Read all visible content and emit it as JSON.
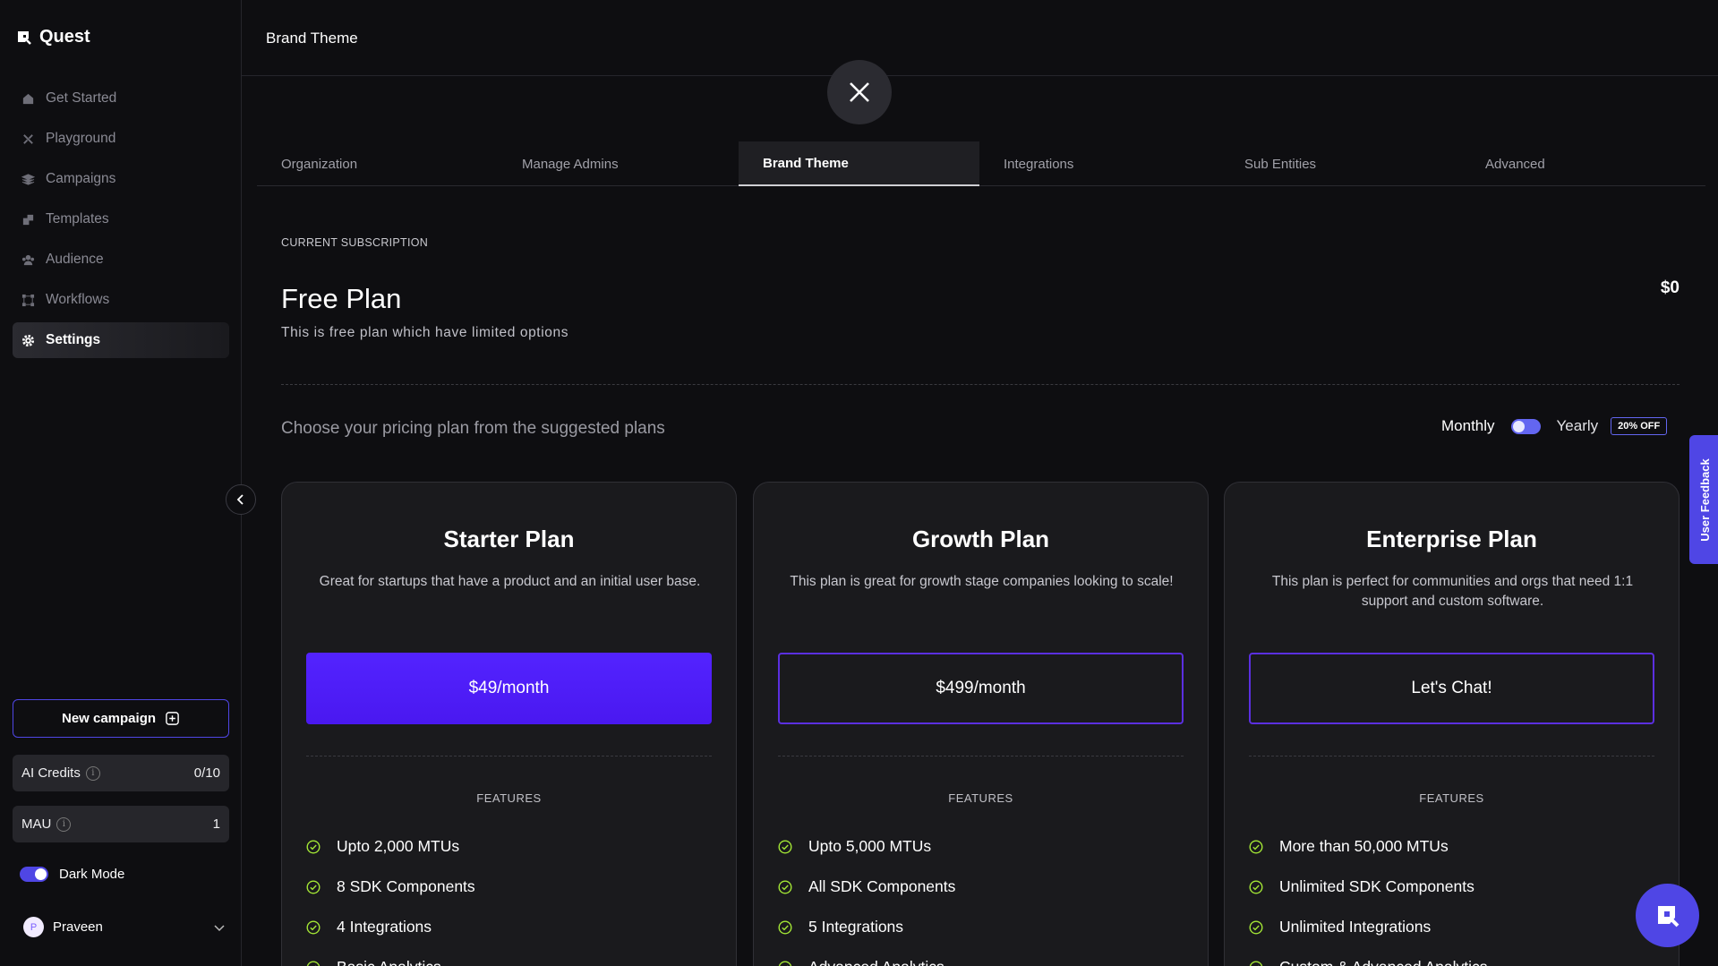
{
  "app": {
    "name": "Quest"
  },
  "sidebar": {
    "items": [
      {
        "label": "Get Started",
        "icon": "home-icon"
      },
      {
        "label": "Playground",
        "icon": "playground-icon"
      },
      {
        "label": "Campaigns",
        "icon": "campaigns-icon"
      },
      {
        "label": "Templates",
        "icon": "templates-icon"
      },
      {
        "label": "Audience",
        "icon": "audience-icon"
      },
      {
        "label": "Workflows",
        "icon": "workflows-icon"
      },
      {
        "label": "Settings",
        "icon": "gear-icon",
        "active": true
      }
    ],
    "new_campaign_label": "New campaign",
    "ai_credits": {
      "label": "AI Credits",
      "value": "0/10"
    },
    "mau": {
      "label": "MAU",
      "value": "1"
    },
    "dark_mode_label": "Dark Mode",
    "dark_mode_on": true,
    "user": {
      "initial": "P",
      "name": "Praveen"
    }
  },
  "header": {
    "title": "Brand Theme"
  },
  "tabs": [
    {
      "label": "Organization"
    },
    {
      "label": "Manage Admins"
    },
    {
      "label": "Brand Theme",
      "active": true
    },
    {
      "label": "Integrations"
    },
    {
      "label": "Sub Entities"
    },
    {
      "label": "Advanced"
    }
  ],
  "subscription": {
    "section_label": "CURRENT SUBSCRIPTION",
    "plan_name": "Free Plan",
    "description": "This is free plan which have limited options",
    "price": "$0"
  },
  "pricing": {
    "prompt": "Choose your pricing plan from the suggested plans",
    "monthly_label": "Monthly",
    "yearly_label": "Yearly",
    "discount_label": "20% OFF",
    "plans": [
      {
        "name": "Starter Plan",
        "description": "Great for startups that have a product and an initial user base.",
        "cta": "$49/month",
        "features_label": "FEATURES",
        "features": [
          "Upto 2,000 MTUs",
          "8 SDK Components",
          "4 Integrations",
          "Basic Analytics"
        ]
      },
      {
        "name": "Growth Plan",
        "description": "This plan is great for growth stage companies looking to scale!",
        "cta": "$499/month",
        "features_label": "FEATURES",
        "features": [
          "Upto 5,000 MTUs",
          "All SDK Components",
          "5 Integrations",
          "Advanced Analytics"
        ]
      },
      {
        "name": "Enterprise Plan",
        "description": "This plan is perfect for communities and orgs that need 1:1 support and custom software.",
        "cta": "Let's Chat!",
        "features_label": "FEATURES",
        "features": [
          "More than 50,000 MTUs",
          "Unlimited SDK Components",
          "Unlimited Integrations",
          "Custom & Advanced Analytics"
        ]
      }
    ]
  },
  "feedback": {
    "label": "User Feedback"
  },
  "colors": {
    "accent": "#4f46e5",
    "cta_fill": "#5323ff",
    "check": "#a3e635",
    "background": "#0e0e11"
  }
}
